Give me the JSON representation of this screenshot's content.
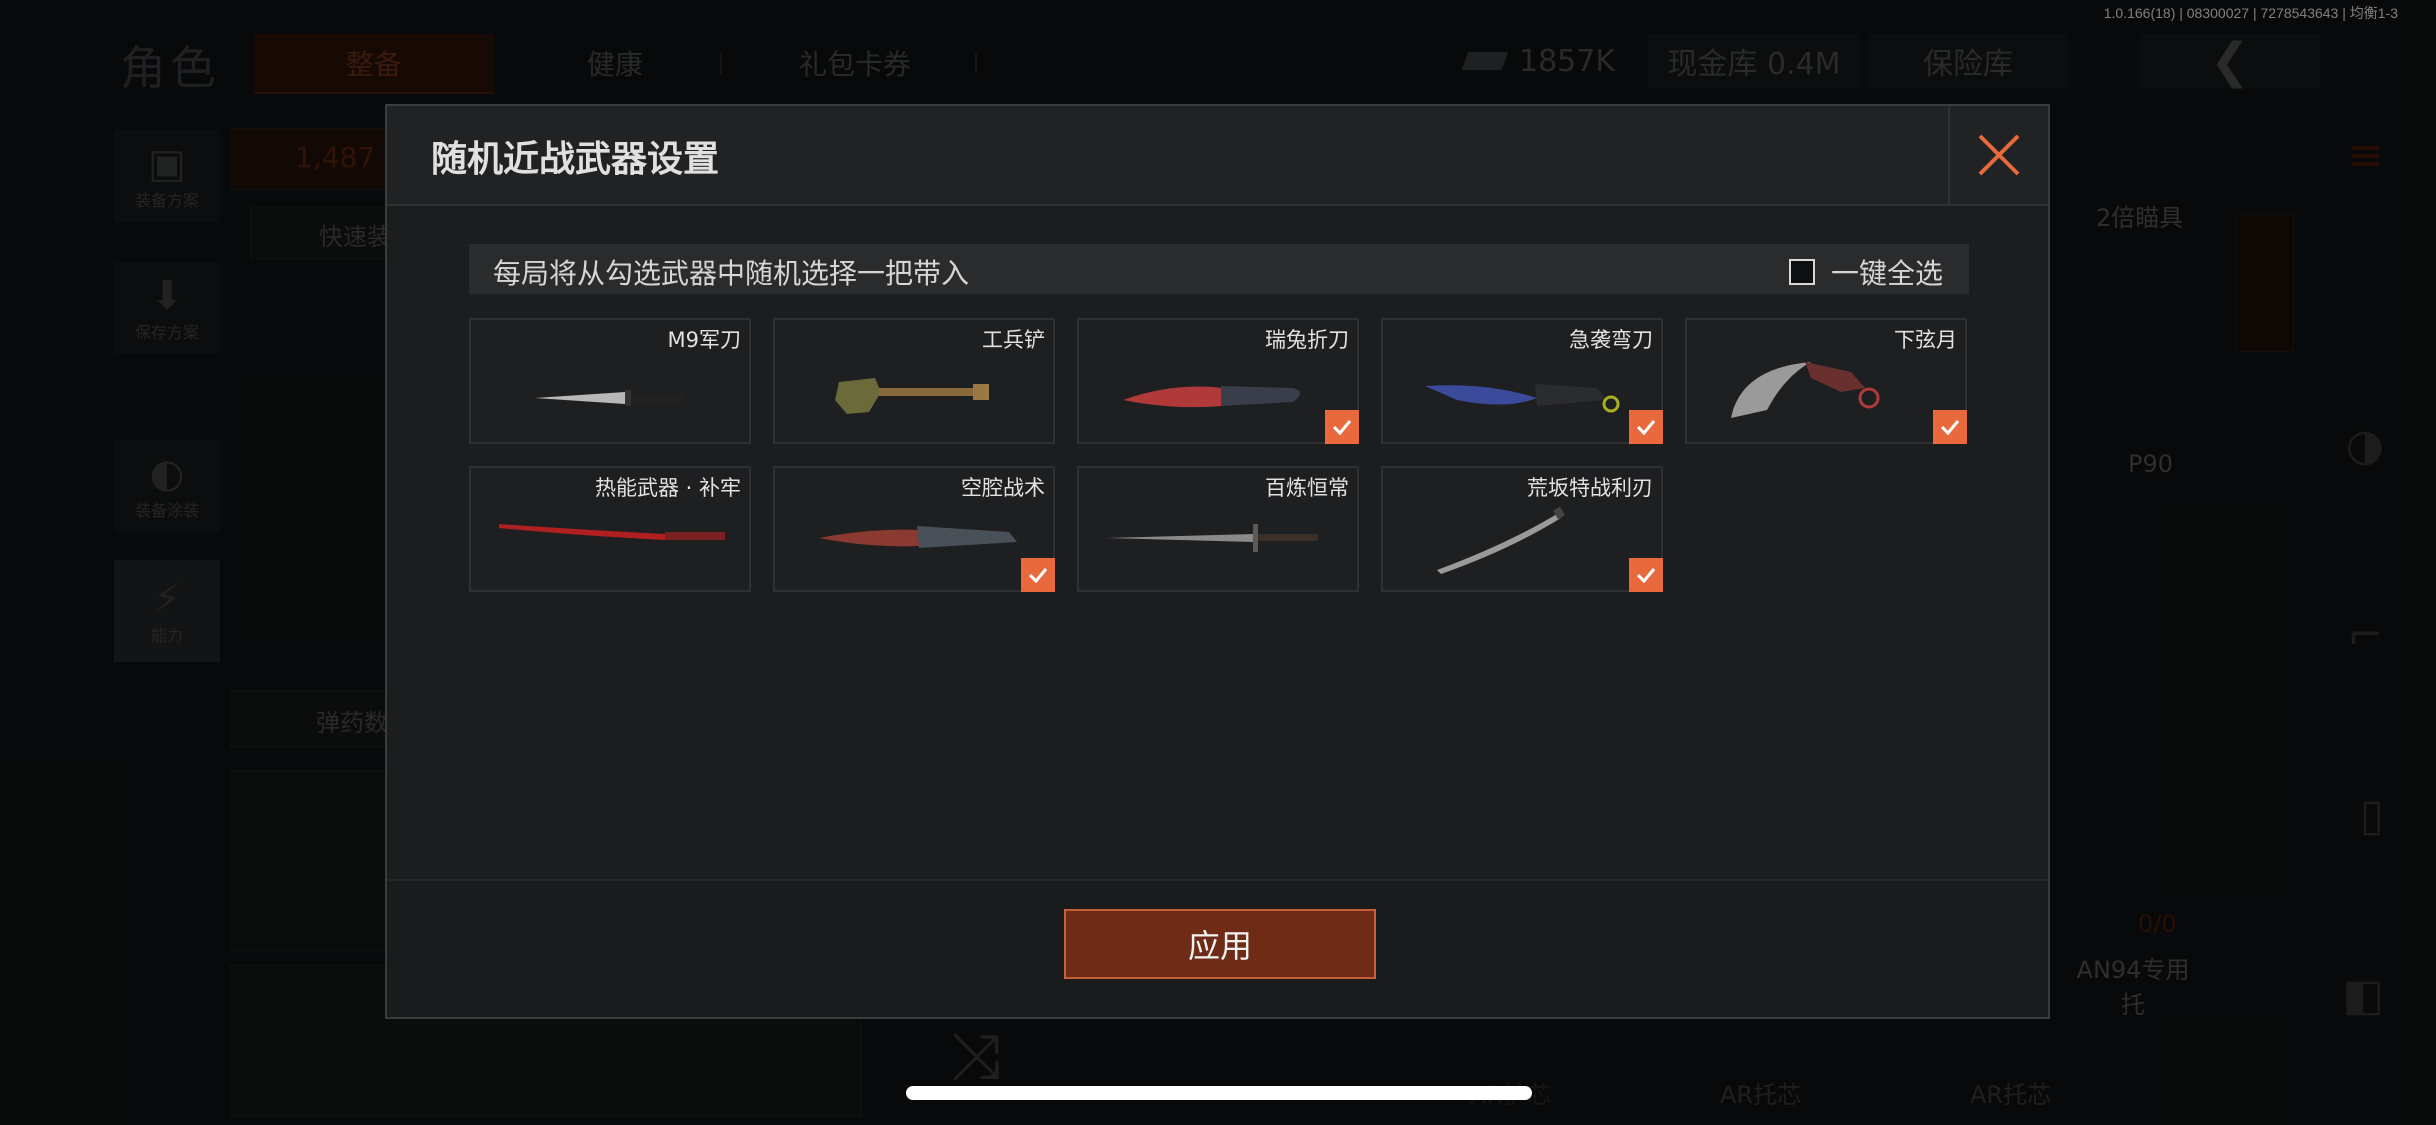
{
  "build_info": "1.0.166(18) | 08300027 | 7278543643 | 均衡1-3",
  "background": {
    "title": "角色",
    "tabs": [
      {
        "label": "整备",
        "active": true
      },
      {
        "label": "健康",
        "active": false
      },
      {
        "label": "礼包卡券",
        "active": false
      }
    ],
    "currency_amount": "1857K",
    "cash_vault": "现金库 0.4M",
    "safe_box": "保险库",
    "sidebar": [
      {
        "label": "装备方案",
        "icon": "vest-icon"
      },
      {
        "label": "保存方案",
        "icon": "download-icon"
      },
      {
        "label": "装备涂装",
        "icon": "helmet-icon"
      },
      {
        "label": "能力",
        "icon": "lightning-icon"
      }
    ],
    "armor_value": "1,487",
    "quick_equip": "快速装",
    "ammo_label": "弹药数",
    "scope_label": "2倍瞄具",
    "weapon_p90": "P90",
    "ammo_count": "0/0",
    "an94_label": "AN94专用托",
    "ar_labels": [
      "AR托芯",
      "AR托芯",
      "AR护芯"
    ]
  },
  "modal": {
    "title": "随机近战武器设置",
    "info_text": "每局将从勾选武器中随机选择一把带入",
    "select_all_label": "一键全选",
    "select_all_checked": false,
    "apply_label": "应用",
    "accent_color": "#e86a3c",
    "weapons": [
      {
        "name": "M9军刀",
        "checked": false,
        "kind": "bayonet"
      },
      {
        "name": "工兵铲",
        "checked": false,
        "kind": "shovel"
      },
      {
        "name": "瑞兔折刀",
        "checked": true,
        "kind": "folding-knife"
      },
      {
        "name": "急袭弯刀",
        "checked": true,
        "kind": "curved-blade"
      },
      {
        "name": "下弦月",
        "checked": true,
        "kind": "karambit"
      },
      {
        "name": "热能武器 · 补牢",
        "checked": false,
        "kind": "katana"
      },
      {
        "name": "空腔战术",
        "checked": true,
        "kind": "tactical-knife"
      },
      {
        "name": "百炼恒常",
        "checked": false,
        "kind": "sword"
      },
      {
        "name": "荒坂特战利刃",
        "checked": true,
        "kind": "thin-katana"
      }
    ]
  }
}
